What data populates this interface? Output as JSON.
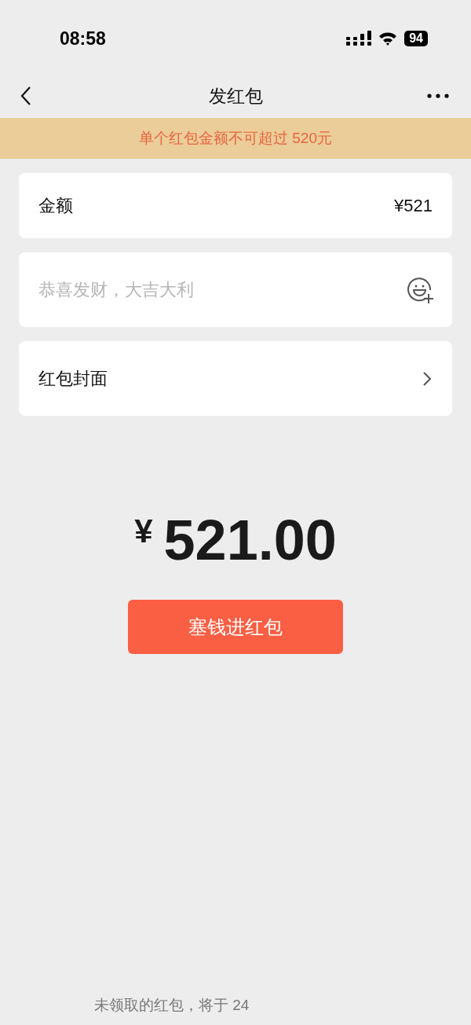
{
  "status_bar": {
    "time": "08:58",
    "battery": "94"
  },
  "nav": {
    "title": "发红包"
  },
  "notice": "单个红包金额不可超过 520元",
  "amount_field": {
    "label": "金额",
    "value": "¥521"
  },
  "greeting_field": {
    "placeholder": "恭喜发财，大吉大利"
  },
  "cover_row": {
    "label": "红包封面"
  },
  "total": {
    "currency": "¥",
    "value": "521.00"
  },
  "submit_button": "塞钱进红包",
  "footer_note": "未领取的红包，将于 24"
}
